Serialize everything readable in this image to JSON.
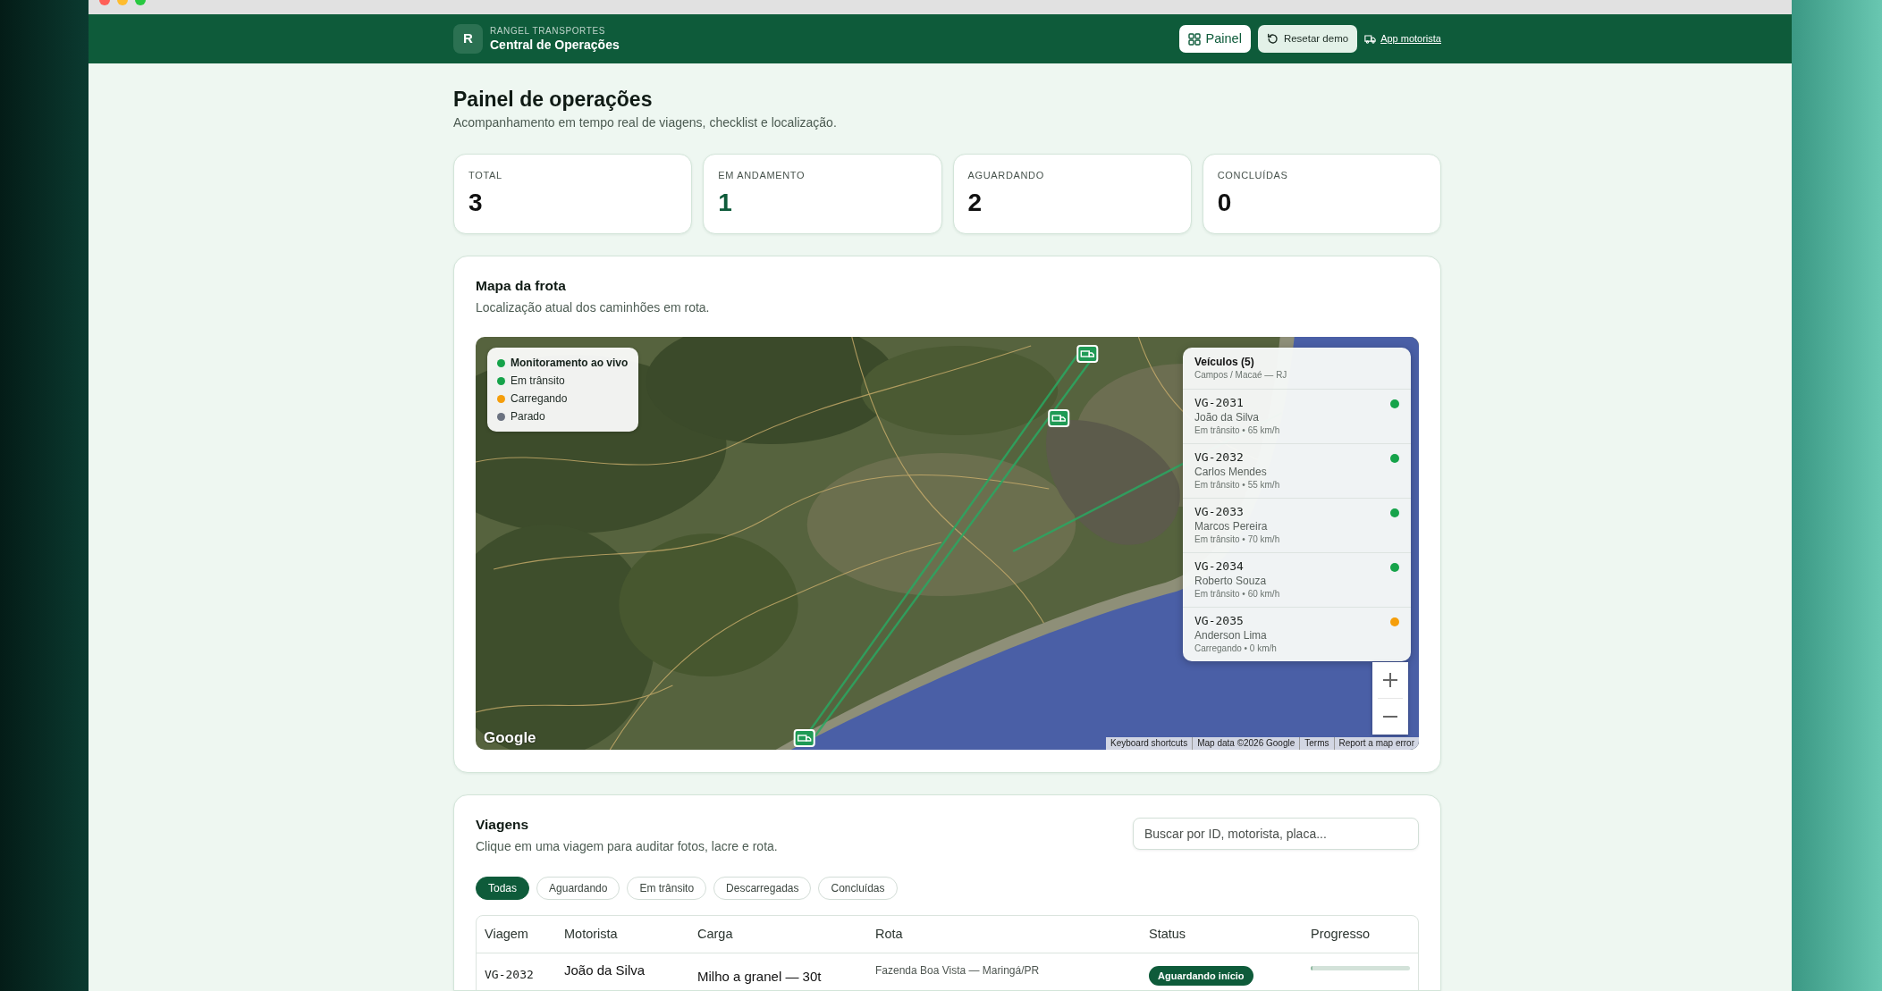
{
  "header": {
    "brand_initial": "R",
    "brand_name": "RANGEL TRANSPORTES",
    "app_title": "Central de Operações",
    "actions": [
      {
        "label": "Painel",
        "kind": "solid"
      },
      {
        "label": "Resetar demo",
        "kind": "soft"
      },
      {
        "label": "App motorista",
        "kind": "link"
      }
    ]
  },
  "page": {
    "title": "Painel de operações",
    "subtitle": "Acompanhamento em tempo real de viagens, checklist e localização."
  },
  "stats": [
    {
      "label": "TOTAL",
      "value": "3",
      "highlight": false
    },
    {
      "label": "EM ANDAMENTO",
      "value": "1",
      "highlight": true
    },
    {
      "label": "AGUARDANDO",
      "value": "2",
      "highlight": false
    },
    {
      "label": "CONCLUÍDAS",
      "value": "0",
      "highlight": false
    }
  ],
  "fleet_map": {
    "title": "Mapa da frota",
    "subtitle": "Localização atual dos caminhões em rota.",
    "legend": [
      {
        "kind": "title",
        "label": "Monitoramento ao vivo",
        "color": "#16a34a"
      },
      {
        "kind": "item",
        "label": "Em trânsito",
        "color": "#16a34a"
      },
      {
        "kind": "item",
        "label": "Carregando",
        "color": "#f59e0b"
      },
      {
        "kind": "item",
        "label": "Parado",
        "color": "#6b7280"
      }
    ],
    "vehicles_panel": {
      "title": "Veículos (5)",
      "subtitle": "Campos / Macaé — RJ",
      "vehicles": [
        {
          "code": "VG-2031",
          "driver": "João da Silva",
          "status": "Em trânsito • 65 km/h",
          "color": "#16a34a"
        },
        {
          "code": "VG-2032",
          "driver": "Carlos Mendes",
          "status": "Em trânsito • 55 km/h",
          "color": "#16a34a"
        },
        {
          "code": "VG-2033",
          "driver": "Marcos Pereira",
          "status": "Em trânsito • 70 km/h",
          "color": "#16a34a"
        },
        {
          "code": "VG-2034",
          "driver": "Roberto Souza",
          "status": "Em trânsito • 60 km/h",
          "color": "#16a34a"
        },
        {
          "code": "VG-2035",
          "driver": "Anderson Lima",
          "status": "Carregando • 0 km/h",
          "color": "#f59e0b"
        }
      ]
    },
    "logo": "Google",
    "attribution": [
      "Keyboard shortcuts",
      "Map data ©2026 Google",
      "Terms",
      "Report a map error"
    ]
  },
  "trips": {
    "title": "Viagens",
    "subtitle": "Clique em uma viagem para auditar fotos, lacre e rota.",
    "search": {
      "placeholder": "Buscar por ID, motorista, placa..."
    },
    "filters": [
      {
        "label": "Todas",
        "selected": true
      },
      {
        "label": "Aguardando",
        "selected": false
      },
      {
        "label": "Em trânsito",
        "selected": false
      },
      {
        "label": "Descarregadas",
        "selected": false
      },
      {
        "label": "Concluídas",
        "selected": false
      }
    ],
    "table": {
      "columns": [
        "Viagem",
        "Motorista",
        "Carga",
        "Rota",
        "Status",
        "Progresso"
      ],
      "rows": [
        {
          "trip": "VG-2032",
          "driver": "João da Silva",
          "cargo": "Milho a granel — 30t",
          "route": "Fazenda Boa Vista — Maringá/PR",
          "status": "Aguardando início",
          "level": 0
        }
      ]
    }
  }
}
